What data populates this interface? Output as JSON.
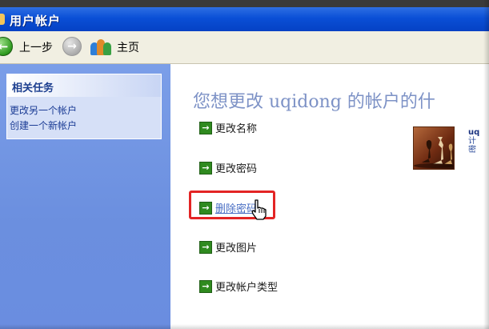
{
  "window": {
    "title": "用户帐户"
  },
  "toolbar": {
    "back_label": "上一步",
    "home_label": "主页",
    "back_icon": "back-arrow-icon",
    "forward_icon": "forward-arrow-icon",
    "home_icon": "users-icon"
  },
  "sidebar": {
    "panel_title": "相关任务",
    "links": [
      "更改另一个帐户",
      "创建一个新帐户"
    ]
  },
  "main": {
    "heading": "您想更改 uqidong 的帐户的什",
    "actions": [
      "更改名称",
      "更改密码",
      "删除密码",
      "更改图片",
      "更改帐户类型"
    ],
    "highlighted_action": "删除密码"
  },
  "account": {
    "name": "uq",
    "line2": "计",
    "line3": "密"
  },
  "colors": {
    "title_bar": "#0a4fd6",
    "sidebar": "#6b8fdf",
    "heading": "#7d92c6",
    "highlight": "#e32424",
    "action_arrow": "#2f8a1f"
  }
}
